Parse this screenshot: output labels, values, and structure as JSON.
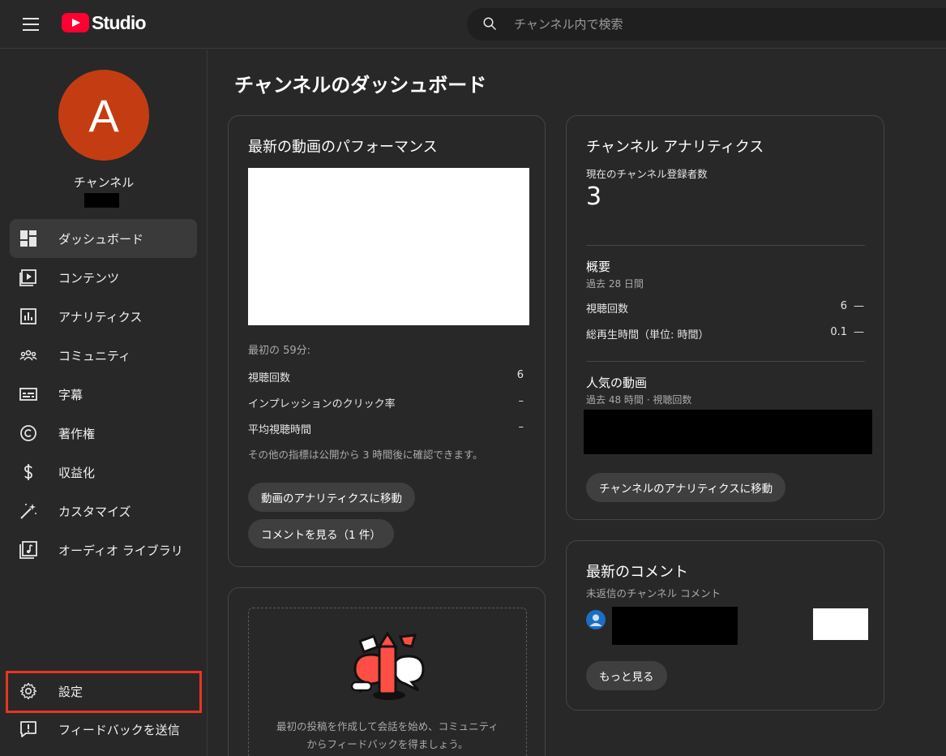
{
  "header": {
    "app_name": "Studio",
    "search_placeholder": "チャンネル内で検索"
  },
  "sidebar": {
    "avatar_letter": "A",
    "channel_label": "チャンネル",
    "items": [
      {
        "label": "ダッシュボード",
        "icon": "dashboard-icon",
        "active": true
      },
      {
        "label": "コンテンツ",
        "icon": "content-icon"
      },
      {
        "label": "アナリティクス",
        "icon": "analytics-icon"
      },
      {
        "label": "コミュニティ",
        "icon": "community-icon"
      },
      {
        "label": "字幕",
        "icon": "subtitles-icon"
      },
      {
        "label": "著作権",
        "icon": "copyright-icon"
      },
      {
        "label": "収益化",
        "icon": "dollar-icon"
      },
      {
        "label": "カスタマイズ",
        "icon": "magic-wand-icon"
      },
      {
        "label": "オーディオ ライブラリ",
        "icon": "audio-library-icon"
      }
    ],
    "bottom": [
      {
        "label": "設定",
        "icon": "gear-icon"
      },
      {
        "label": "フィードバックを送信",
        "icon": "feedback-icon"
      }
    ],
    "highlight_color": "#ea3323"
  },
  "main": {
    "title": "チャンネルのダッシュボード",
    "latest_video": {
      "title": "最新の動画のパフォーマンス",
      "first_period": "最初の 59分:",
      "metrics": [
        {
          "label": "視聴回数",
          "value": "6"
        },
        {
          "label": "インプレッションのクリック率",
          "value": "–"
        },
        {
          "label": "平均視聴時間",
          "value": "–"
        }
      ],
      "note": "その他の指標は公開から 3 時間後に確認できます。",
      "analytics_button": "動画のアナリティクスに移動",
      "comments_button": "コメントを見る（1 件）"
    },
    "community_card": {
      "text_line1": "最初の投稿を作成して会話を始め、コミュニティ",
      "text_line2": "からフィードバックを得ましょう。"
    },
    "channel_analytics": {
      "title": "チャンネル アナリティクス",
      "subscribers_label": "現在のチャンネル登録者数",
      "subscribers_value": "3",
      "summary_title": "概要",
      "summary_period": "過去 28 日間",
      "summary_rows": [
        {
          "label": "視聴回数",
          "value": "6",
          "trend": "—"
        },
        {
          "label": "総再生時間（単位: 時間）",
          "value": "0.1",
          "trend": "—"
        }
      ],
      "popular_title": "人気の動画",
      "popular_period": "過去 48 時間 · 視聴回数",
      "button": "チャンネルのアナリティクスに移動"
    },
    "latest_comments": {
      "title": "最新のコメント",
      "subtitle": "未返信のチャンネル コメント",
      "more_button": "もっと見る"
    }
  },
  "colors": {
    "background": "#282828",
    "brand_red": "#ff0033",
    "avatar": "#c43d12"
  }
}
